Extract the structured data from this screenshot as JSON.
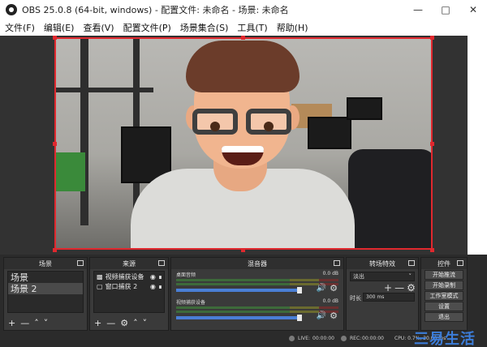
{
  "window": {
    "title": "OBS 25.0.8 (64-bit, windows) - 配置文件: 未命名 - 场景: 未命名",
    "minimize_icon": "minimize-icon",
    "maximize_icon": "maximize-icon",
    "close_icon": "close-icon"
  },
  "menu": [
    "文件(F)",
    "编辑(E)",
    "查看(V)",
    "配置文件(P)",
    "场景集合(S)",
    "工具(T)",
    "帮助(H)"
  ],
  "docks": {
    "scenes": {
      "title": "场景",
      "items": [
        "场景",
        "场景 2"
      ],
      "selected": 1
    },
    "sources": {
      "title": "来源",
      "items": [
        "视频捕获设备",
        "窗口捕获 2"
      ]
    },
    "mixer": {
      "title": "混音器",
      "tracks": [
        {
          "name": "桌面音频",
          "db": "0.0 dB",
          "volume": 0.9
        },
        {
          "name": "视频捕获设备",
          "db": "0.0 dB",
          "volume": 0.9
        }
      ]
    },
    "transitions": {
      "title": "转场特效",
      "type": "淡出",
      "duration_label": "时长",
      "duration": "300 ms"
    },
    "controls": {
      "title": "控件",
      "buttons": [
        "开始推流",
        "开始录制",
        "工作室模式",
        "设置",
        "退出"
      ]
    }
  },
  "status": {
    "live_label": "LIVE:",
    "live_time": "00:00:00",
    "rec_label": "REC:",
    "rec_time": "00:00:00",
    "cpu": "CPU: 0.7%, 30.00 fps"
  },
  "watermark": "三易生活",
  "colors": {
    "selection_border": "#e0282e",
    "slider": "#4a7fd6",
    "background": "#2b2b2b"
  }
}
